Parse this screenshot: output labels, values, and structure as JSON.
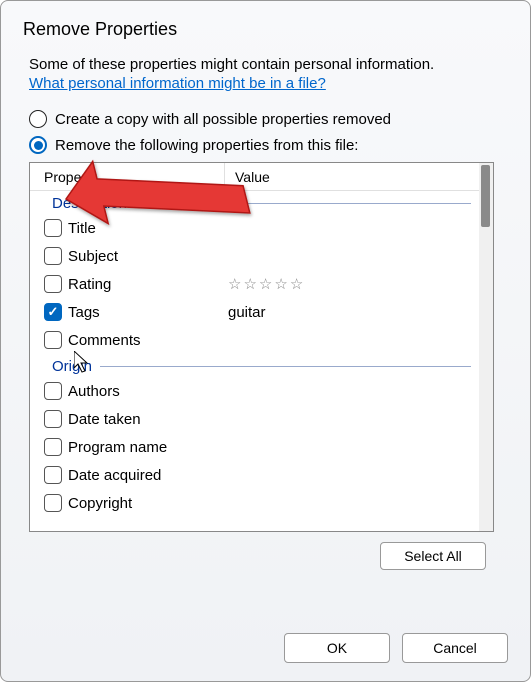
{
  "dialog": {
    "title": "Remove Properties",
    "intro": "Some of these properties might contain personal information.",
    "link": "What personal information might be in a file?"
  },
  "radios": {
    "option1": "Create a copy with all possible properties removed",
    "option2": "Remove the following properties from this file:"
  },
  "headers": {
    "property": "Property",
    "value": "Value"
  },
  "sections": {
    "description": "Description",
    "origin": "Origin"
  },
  "props": {
    "title": "Title",
    "subject": "Subject",
    "rating": "Rating",
    "tags": "Tags",
    "comments": "Comments",
    "authors": "Authors",
    "date_taken": "Date taken",
    "program_name": "Program name",
    "date_acquired": "Date acquired",
    "copyright": "Copyright"
  },
  "values": {
    "tags": "guitar"
  },
  "buttons": {
    "select_all": "Select All",
    "ok": "OK",
    "cancel": "Cancel"
  }
}
